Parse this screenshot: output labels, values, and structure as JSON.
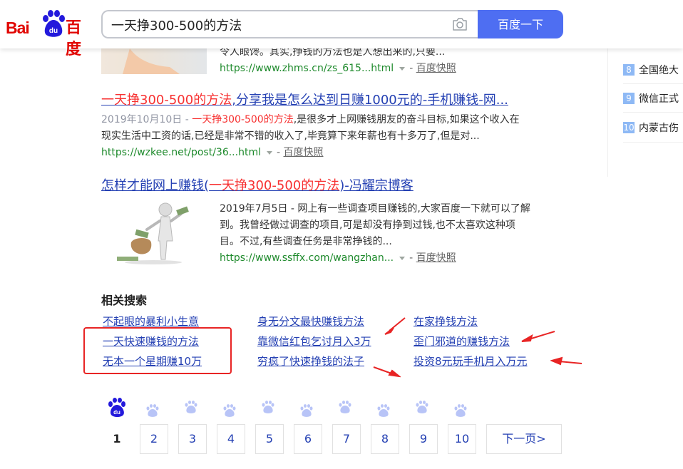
{
  "header": {
    "logo_left": "Bai",
    "logo_right": "百度",
    "logo_paw_text": "du",
    "search_value": "一天挣300-500的方法",
    "search_button": "百度一下"
  },
  "results": [
    {
      "abstract_tail": "令人眼馋。其实,挣钱的方法也是人想出来的,只要...",
      "url": "https://www.zhms.cn/zs_615...html",
      "dash": "-",
      "snapshot": "百度快照"
    },
    {
      "title_em": "一天挣300-500的方法",
      "title_rest": ",分享我是怎么达到日赚1000元的-手机赚钱-网...",
      "date": "2019年10月10日 - ",
      "abs_em": "一天挣300-500的方法",
      "abs_line1": ",是很多才上网赚钱朋友的奋斗目标,如果这个收入在",
      "abs_line2": "现实生活中工资的话,已经是非常不错的收入了,毕竟算下来年薪也有十多万了,但是对...",
      "url": "https://wzkee.net/post/36...html",
      "dash": "-",
      "snapshot": "百度快照"
    },
    {
      "title_pre": "怎样才能网上赚钱(",
      "title_em": "一天挣300-500的方法",
      "title_post": ")-冯耀宗博客",
      "abs_line1": "2019年7月5日 - 网上有一些调查项目赚钱的,大家百度一下就可以了解",
      "abs_line2": "到。我曾经做过调查的项目,可是却没有挣到过钱,也不太喜欢这种项",
      "abs_line3": "目。不过,有些调查任务是非常挣钱的...",
      "url": "https://www.ssffx.com/wangzhan...",
      "dash": "-",
      "snapshot": "百度快照"
    }
  ],
  "related": {
    "title": "相关搜索",
    "col1": [
      "不起眼的暴利小生意",
      "一天快速赚钱的方法",
      "无本一个星期赚10万"
    ],
    "col2": [
      "身无分文最快赚钱方法",
      "靠微信红包乞讨月入3万",
      "穷疯了快速挣钱的法子"
    ],
    "col3": [
      "在家挣钱方法",
      "歪门邪道的赚钱方法",
      "投资8元玩手机月入万元"
    ]
  },
  "hot_list": [
    {
      "num": "8",
      "text": "全国绝大"
    },
    {
      "num": "9",
      "text": "微信正式"
    },
    {
      "num": "10",
      "text": "内蒙古伤"
    }
  ],
  "pagination": {
    "current": "1",
    "pages": [
      "2",
      "3",
      "4",
      "5",
      "6",
      "7",
      "8",
      "9",
      "10"
    ],
    "next": "下一页>"
  },
  "colors": {
    "link": "#2440b3",
    "highlight": "#f73131",
    "url_green": "#1e8a2c",
    "brand_blue": "#4e6ef2",
    "annotation_red": "#e82424"
  }
}
